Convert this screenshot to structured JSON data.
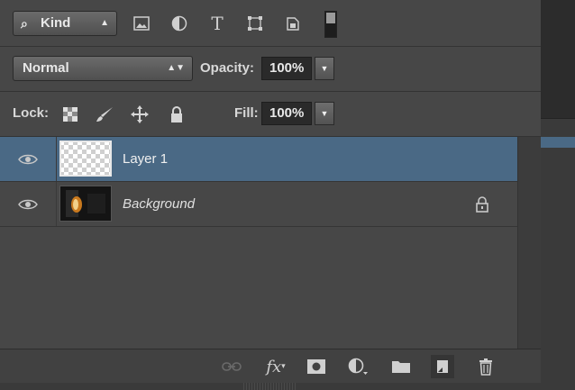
{
  "filter": {
    "kind_label": "Kind",
    "kind_icon": "search-icon",
    "icons": [
      "image-filter-icon",
      "adjustment-filter-icon",
      "type-filter-icon",
      "shape-filter-icon",
      "smart-object-filter-icon"
    ]
  },
  "blend": {
    "mode": "Normal",
    "opacity_label": "Opacity:",
    "opacity_value": "100%"
  },
  "lock": {
    "label": "Lock:",
    "icons": [
      "lock-transparent-pixels-icon",
      "lock-image-pixels-icon",
      "lock-position-icon",
      "lock-all-icon"
    ],
    "fill_label": "Fill:",
    "fill_value": "100%"
  },
  "layers": [
    {
      "name": "Layer 1",
      "selected": true,
      "visible": true,
      "locked": false,
      "thumbnail": "transparent"
    },
    {
      "name": "Background",
      "selected": false,
      "visible": true,
      "locked": true,
      "thumbnail": "photo"
    }
  ],
  "footer": {
    "icons": [
      "link-layers-icon",
      "fx-icon",
      "add-mask-icon",
      "adjustment-layer-icon",
      "new-group-icon",
      "new-layer-icon",
      "trash-icon"
    ]
  },
  "colors": {
    "panel_bg": "#474747",
    "selected_row": "#4a6985",
    "field_bg": "#2a2a2a"
  }
}
